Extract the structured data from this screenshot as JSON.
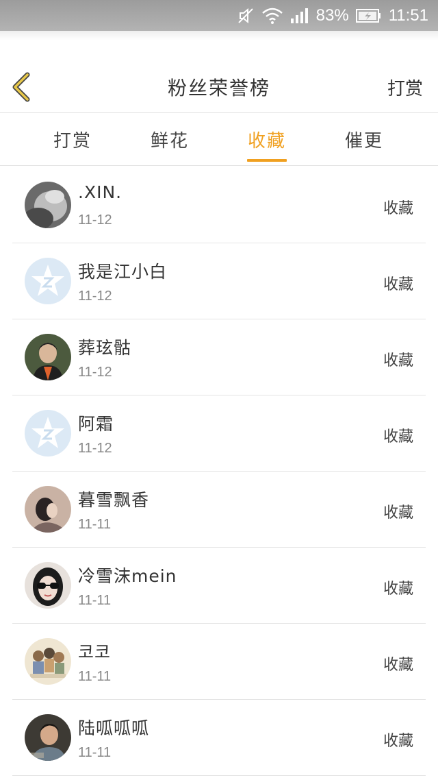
{
  "status_bar": {
    "battery": "83%",
    "time": "11:51"
  },
  "nav": {
    "title": "粉丝荣誉榜",
    "right_action": "打赏"
  },
  "tabs": [
    {
      "label": "打赏",
      "active": false
    },
    {
      "label": "鲜花",
      "active": false
    },
    {
      "label": "收藏",
      "active": true
    },
    {
      "label": "催更",
      "active": false
    }
  ],
  "colors": {
    "accent": "#f0a020",
    "back_arrow": "#e8c84a"
  },
  "fans": [
    {
      "name": ".XIN.",
      "date": "11-12",
      "action": "收藏",
      "avatar": "gray-photo-avatar"
    },
    {
      "name": "我是江小白",
      "date": "11-12",
      "action": "收藏",
      "avatar": "default-star-avatar"
    },
    {
      "name": "葬玹骷",
      "date": "11-12",
      "action": "收藏",
      "avatar": "person-photo-avatar"
    },
    {
      "name": "阿霜",
      "date": "11-12",
      "action": "收藏",
      "avatar": "default-star-avatar"
    },
    {
      "name": "暮雪飘香",
      "date": "11-11",
      "action": "收藏",
      "avatar": "person-photo-avatar"
    },
    {
      "name": "冷雪沫mein",
      "date": "11-11",
      "action": "收藏",
      "avatar": "sunglasses-photo-avatar"
    },
    {
      "name": "코코",
      "date": "11-11",
      "action": "收藏",
      "avatar": "cartoon-avatar"
    },
    {
      "name": "陆呱呱呱",
      "date": "11-11",
      "action": "收藏",
      "avatar": "person-photo-avatar"
    }
  ]
}
